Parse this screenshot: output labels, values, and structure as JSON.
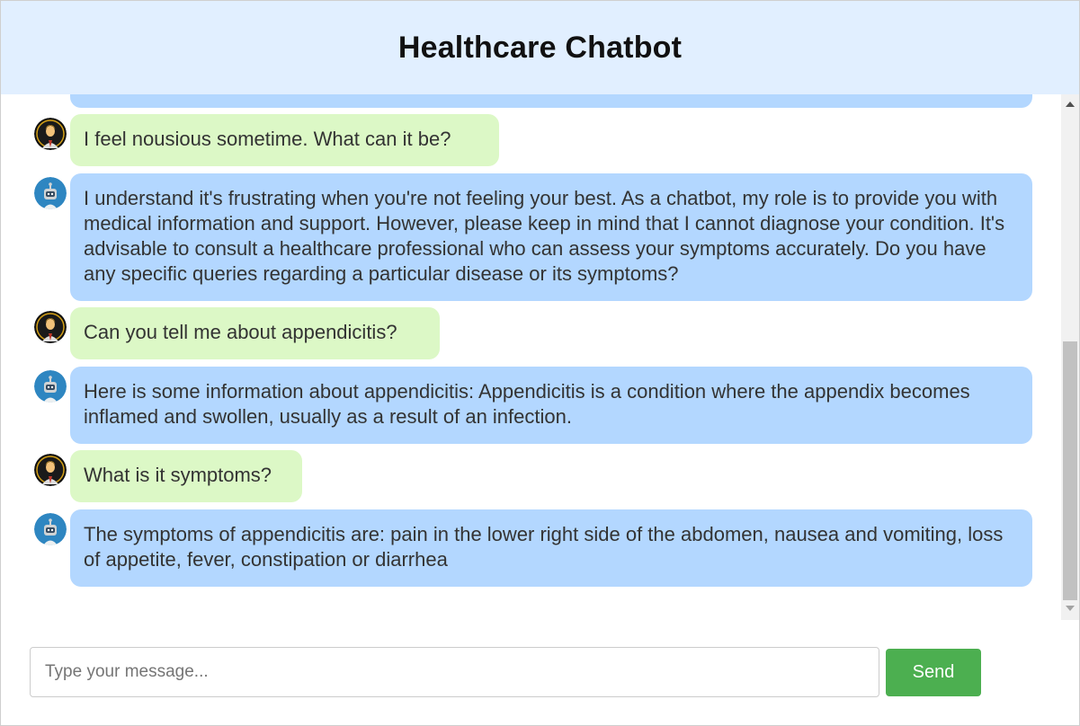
{
  "app": {
    "title": "Healthcare Chatbot"
  },
  "colors": {
    "header_bg": "#e1efff",
    "user_bubble": "#dcf8c6",
    "bot_bubble": "#b3d7ff",
    "send_button": "#4caf50"
  },
  "messages": [
    {
      "sender": "bot",
      "avatar": "robot-avatar-icon",
      "text": ""
    },
    {
      "sender": "user",
      "avatar": "user-avatar-icon",
      "text": "I feel nousious sometime. What can it be?"
    },
    {
      "sender": "bot",
      "avatar": "robot-avatar-icon",
      "text": "I understand it's frustrating when you're not feeling your best. As a chatbot, my role is to provide you with medical information and support. However, please keep in mind that I cannot diagnose your condition. It's advisable to consult a healthcare professional who can assess your symptoms accurately. Do you have any specific queries regarding a particular disease or its symptoms?"
    },
    {
      "sender": "user",
      "avatar": "user-avatar-icon",
      "text": "Can you tell me about appendicitis?"
    },
    {
      "sender": "bot",
      "avatar": "robot-avatar-icon",
      "text": "Here is some information about appendicitis: Appendicitis is a condition where the appendix becomes inflamed and swollen, usually as a result of an infection."
    },
    {
      "sender": "user",
      "avatar": "user-avatar-icon",
      "text": "What is it symptoms?"
    },
    {
      "sender": "bot",
      "avatar": "robot-avatar-icon",
      "text": "The symptoms of appendicitis are: pain in the lower right side of the abdomen, nausea and vomiting, loss of appetite, fever, constipation or diarrhea"
    }
  ],
  "composer": {
    "input_value": "",
    "placeholder": "Type your message...",
    "send_label": "Send"
  },
  "scroll": {
    "position_fraction": 0.48
  }
}
